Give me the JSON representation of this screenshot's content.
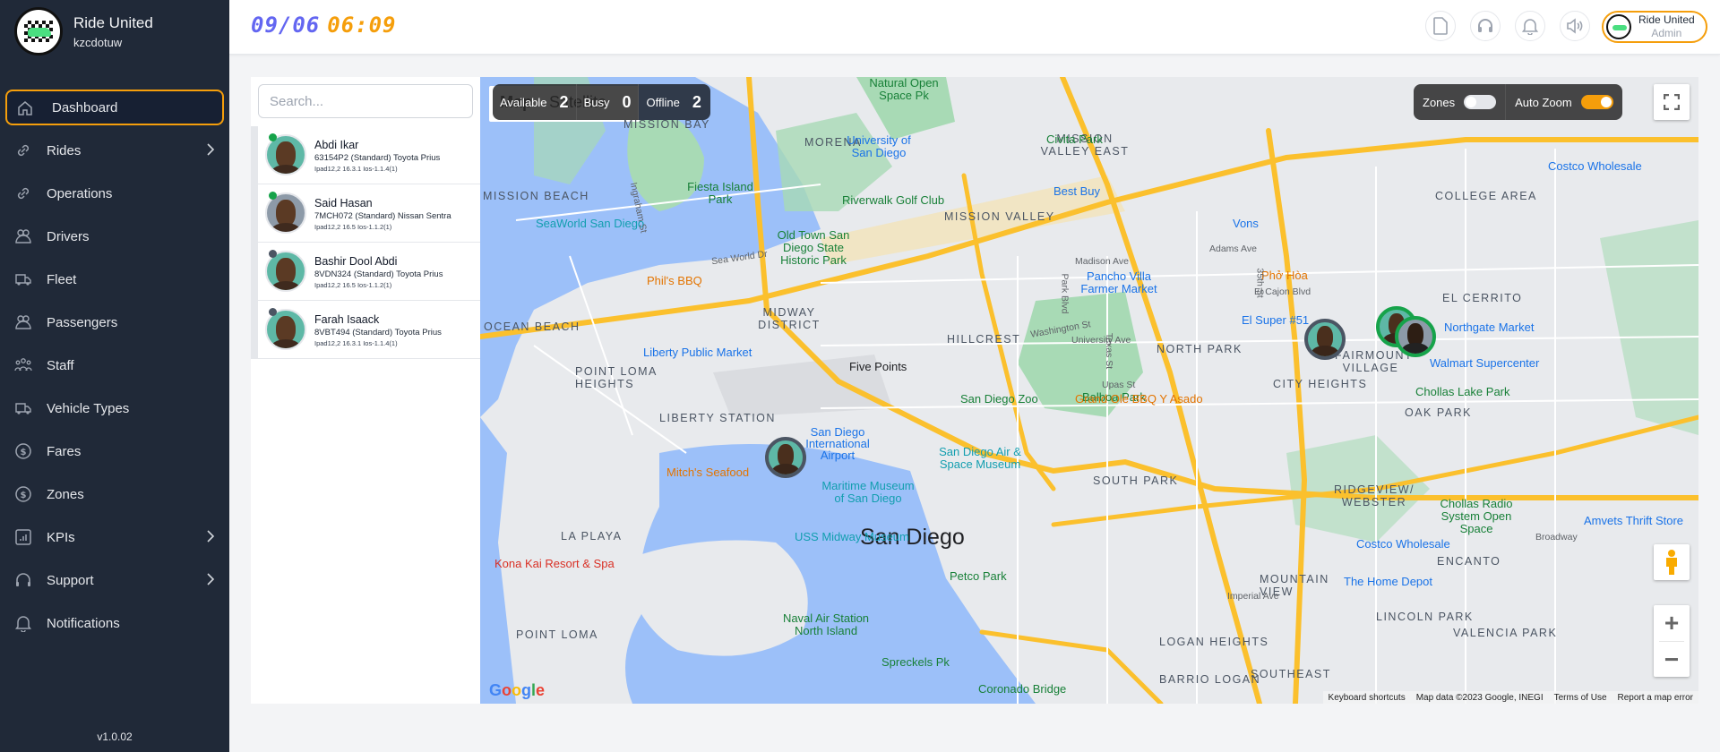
{
  "app": {
    "name": "Ride United",
    "tenant": "kzcdotuw",
    "version": "v1.0.02"
  },
  "sidebar": {
    "items": [
      {
        "label": "Dashboard",
        "icon": "home-icon",
        "active": true,
        "has_submenu": false
      },
      {
        "label": "Rides",
        "icon": "link-icon",
        "active": false,
        "has_submenu": true
      },
      {
        "label": "Operations",
        "icon": "link-icon",
        "active": false,
        "has_submenu": false
      },
      {
        "label": "Drivers",
        "icon": "users-icon",
        "active": false,
        "has_submenu": false
      },
      {
        "label": "Fleet",
        "icon": "truck-icon",
        "active": false,
        "has_submenu": false
      },
      {
        "label": "Passengers",
        "icon": "users-icon",
        "active": false,
        "has_submenu": false
      },
      {
        "label": "Staff",
        "icon": "user-group-icon",
        "active": false,
        "has_submenu": false
      },
      {
        "label": "Vehicle Types",
        "icon": "truck-icon",
        "active": false,
        "has_submenu": false
      },
      {
        "label": "Fares",
        "icon": "dollar-circle-icon",
        "active": false,
        "has_submenu": false
      },
      {
        "label": "Zones",
        "icon": "dollar-circle-icon",
        "active": false,
        "has_submenu": false
      },
      {
        "label": "KPIs",
        "icon": "bar-chart-icon",
        "active": false,
        "has_submenu": true
      },
      {
        "label": "Support",
        "icon": "headset-icon",
        "active": false,
        "has_submenu": true
      },
      {
        "label": "Notifications",
        "icon": "bell-icon",
        "active": false,
        "has_submenu": false
      }
    ]
  },
  "header": {
    "date": "09/06",
    "time": "06:09",
    "icons": [
      "document-icon",
      "headset-icon",
      "bell-icon",
      "speaker-icon"
    ],
    "profile": {
      "name": "Ride United",
      "role": "Admin"
    }
  },
  "colors": {
    "accent": "#f59e0b",
    "date": "#6366f1",
    "sidebar_bg": "#202938",
    "online": "#16a34a",
    "offline": "#4b5563"
  },
  "search": {
    "placeholder": "Search...",
    "value": ""
  },
  "drivers": [
    {
      "name": "Abdi Ikar",
      "vehicle": "63154P2 (Standard) Toyota Prius",
      "device": "Ipad12,2 16.3.1 Ios-1.1.4(1)",
      "status": "online"
    },
    {
      "name": "Said Hasan",
      "vehicle": "7MCH072 (Standard) Nissan Sentra",
      "device": "Ipad12,2 16.5 Ios-1.1.2(1)",
      "status": "online"
    },
    {
      "name": "Bashir Dool Abdi",
      "vehicle": "8VDN324 (Standard) Toyota Prius",
      "device": "Ipad12,2 16.5 Ios-1.1.2(1)",
      "status": "offline"
    },
    {
      "name": "Farah Isaack",
      "vehicle": "8VBT494 (Standard) Toyota Prius",
      "device": "Ipad12,2 16.3.1 Ios-1.1.4(1)",
      "status": "offline"
    }
  ],
  "map": {
    "type_buttons": [
      "Map",
      "Satellite"
    ],
    "status": [
      {
        "label": "Available",
        "value": "2"
      },
      {
        "label": "Busy",
        "value": "0"
      },
      {
        "label": "Offline",
        "value": "2"
      }
    ],
    "toggles": [
      {
        "label": "Zones",
        "on": false
      },
      {
        "label": "Auto Zoom",
        "on": true
      }
    ],
    "zoom_in": "+",
    "zoom_out": "−",
    "logo": "Google",
    "attribution": [
      "Keyboard shortcuts",
      "Map data ©2023 Google, INEGI",
      "Terms of Use",
      "Report a map error"
    ],
    "labels": {
      "city": "San Diego",
      "hoods": [
        "MISSION BAY",
        "MISSION BEACH",
        "OCEAN BEACH",
        "POINT LOMA HEIGHTS",
        "LIBERTY STATION",
        "LA PLAYA",
        "POINT LOMA",
        "MIDWAY DISTRICT",
        "MORENA",
        "MISSION VALLEY",
        "MISSION VALLEY EAST",
        "HILLCREST",
        "NORTH PARK",
        "SOUTH PARK",
        "CITY HEIGHTS",
        "FAIRMOUNT VILLAGE",
        "EL CERRITO",
        "COLLEGE AREA",
        "OAK PARK",
        "RIDGEVIEW/ WEBSTER",
        "ENCANTO",
        "MOUNTAIN VIEW",
        "LINCOLN PARK",
        "VALENCIA PARK",
        "LOGAN HEIGHTS",
        "SOUTHEAST",
        "BARRIO LOGAN"
      ],
      "parks": [
        "Natural Open Space Pk",
        "Fiesta Island Park",
        "Riverwalk Golf Club",
        "Old Town San Diego State Historic Park",
        "Civita Park",
        "Balboa Park",
        "San Diego Zoo",
        "Chollas Lake Park",
        "Chollas Radio System Open Space",
        "Petco Park",
        "Naval Air Station North Island",
        "Spreckels Pk",
        "Coronado Bridge"
      ],
      "places_blue": [
        "University of San Diego",
        "Best Buy",
        "Vons",
        "Pancho Villa Farmer Market",
        "El Super #51",
        "Northgate Market",
        "Walmart Supercenter",
        "Costco Wholesale",
        "The Home Depot",
        "San Diego International Airport",
        "Liberty Public Market",
        "Amvets Thrift Store",
        "Costco Wholesale"
      ],
      "places_teal": [
        "SeaWorld San Diego",
        "Maritime Museum of San Diego",
        "USS Midway Museum",
        "San Diego Air & Space Museum"
      ],
      "places_orange": [
        "Phil's BBQ",
        "Mitch's Seafood",
        "Phở Hòa",
        "Grand Ole BBQ Y Asado"
      ],
      "places_red": [
        "Kona Kai Resort & Spa"
      ],
      "streets": [
        "Sea World Dr",
        "Ingraham St",
        "Washington St",
        "University Ave",
        "Madison Ave",
        "Adams Ave",
        "El Cajon Blvd",
        "Park Blvd",
        "Texas St",
        "Upas St",
        "35th St",
        "Five Points",
        "Broadway",
        "Imperial Ave"
      ]
    }
  }
}
